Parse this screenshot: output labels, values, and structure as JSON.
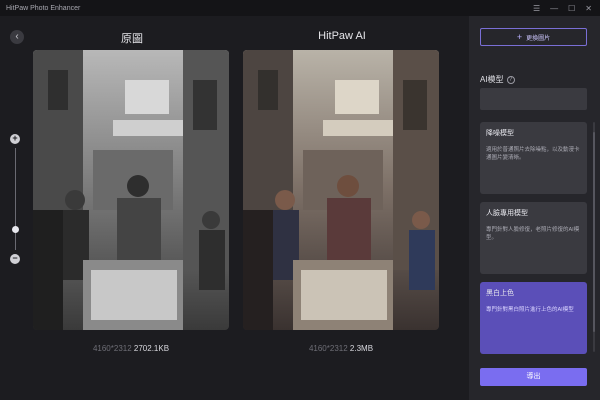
{
  "titlebar": {
    "app_title": "HitPaw Photo Enhancer",
    "menu_icon": "menu-icon",
    "minimize_icon": "minimize-icon",
    "maximize_icon": "maximize-icon",
    "close_icon": "close-icon"
  },
  "main": {
    "back_icon": "back-arrow-icon",
    "left_title": "原圖",
    "right_title": "HitPaw AI",
    "zoom": {
      "plus": "+",
      "minus": "−",
      "level": 0.25
    },
    "left_meta": {
      "dim": "4160*2312",
      "size": "2702.1KB"
    },
    "right_meta": {
      "dim": "4160*2312",
      "size": "2.3MB"
    }
  },
  "sidebar": {
    "change_button": "更換圖片",
    "section_label": "AI模型",
    "info_icon": "info-icon",
    "cards": [
      {
        "title": "降噪模型",
        "desc": "適用於普通照片去除噪點，以及動漫卡通圖片變清晰。",
        "active": false
      },
      {
        "title": "人臉專用模型",
        "desc": "專門針對人臉修復，老照片修復的AI模型。",
        "active": false
      },
      {
        "title": "黑白上色",
        "desc": "專門針對黑白照片進行上色的AI模型",
        "active": true
      }
    ],
    "export_button": "導出"
  },
  "colors": {
    "accent": "#7a6df0",
    "active_card": "#5b4fb8",
    "sidebar_bg": "#26262b",
    "main_bg": "#1c1c20"
  }
}
